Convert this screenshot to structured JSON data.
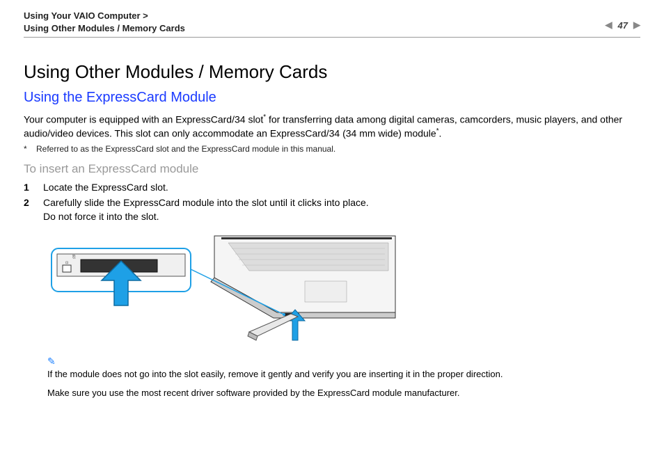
{
  "header": {
    "breadcrumb_line1": "Using Your VAIO Computer >",
    "breadcrumb_line2": "Using Other Modules / Memory Cards",
    "page_number": "47"
  },
  "title": "Using Other Modules / Memory Cards",
  "subtitle": "Using the ExpressCard Module",
  "intro_part1": "Your computer is equipped with an ExpressCard/34 slot",
  "intro_part2": " for transferring data among digital cameras, camcorders, music players, and other audio/video devices. This slot can only accommodate an ExpressCard/34 (34 mm wide) module",
  "intro_end": ".",
  "footnote": "Referred to as the ExpressCard slot and the ExpressCard module in this manual.",
  "procedure_title": "To insert an ExpressCard module",
  "steps": [
    {
      "num": "1",
      "text": "Locate the ExpressCard slot."
    },
    {
      "num": "2",
      "text": "Carefully slide the ExpressCard module into the slot until it clicks into place.\nDo not force it into the slot."
    }
  ],
  "note1": "If the module does not go into the slot easily, remove it gently and verify you are inserting it in the proper direction.",
  "note2": "Make sure you use the most recent driver software provided by the ExpressCard module manufacturer."
}
